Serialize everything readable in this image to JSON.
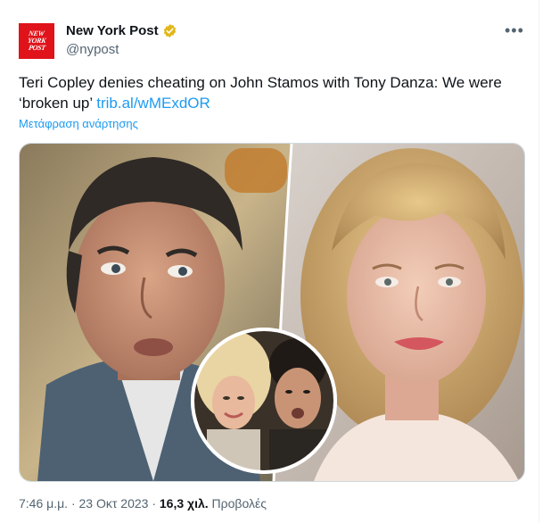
{
  "account": {
    "display_name": "New York Post",
    "handle": "@nypost",
    "verified_icon": "gold-verified-badge",
    "avatar_lines": [
      "NEW",
      "YORK",
      "POST"
    ]
  },
  "menu_icon": "more-options-icon",
  "tweet": {
    "text_before_link": "Teri Copley denies cheating on John Stamos with Tony Danza: We were ‘broken up’ ",
    "link_text": "trib.al/wMExdOR",
    "translate_label": "Μετάφραση ανάρτησης"
  },
  "footer": {
    "time": "7:46 μ.μ.",
    "separator": "·",
    "date": "23 Οκτ 2023",
    "views_count": "16,3 χιλ.",
    "views_label": "Προβολές"
  },
  "colors": {
    "brand_red": "#e0131a",
    "link_blue": "#1d9bf0",
    "muted_gray": "#536471"
  }
}
